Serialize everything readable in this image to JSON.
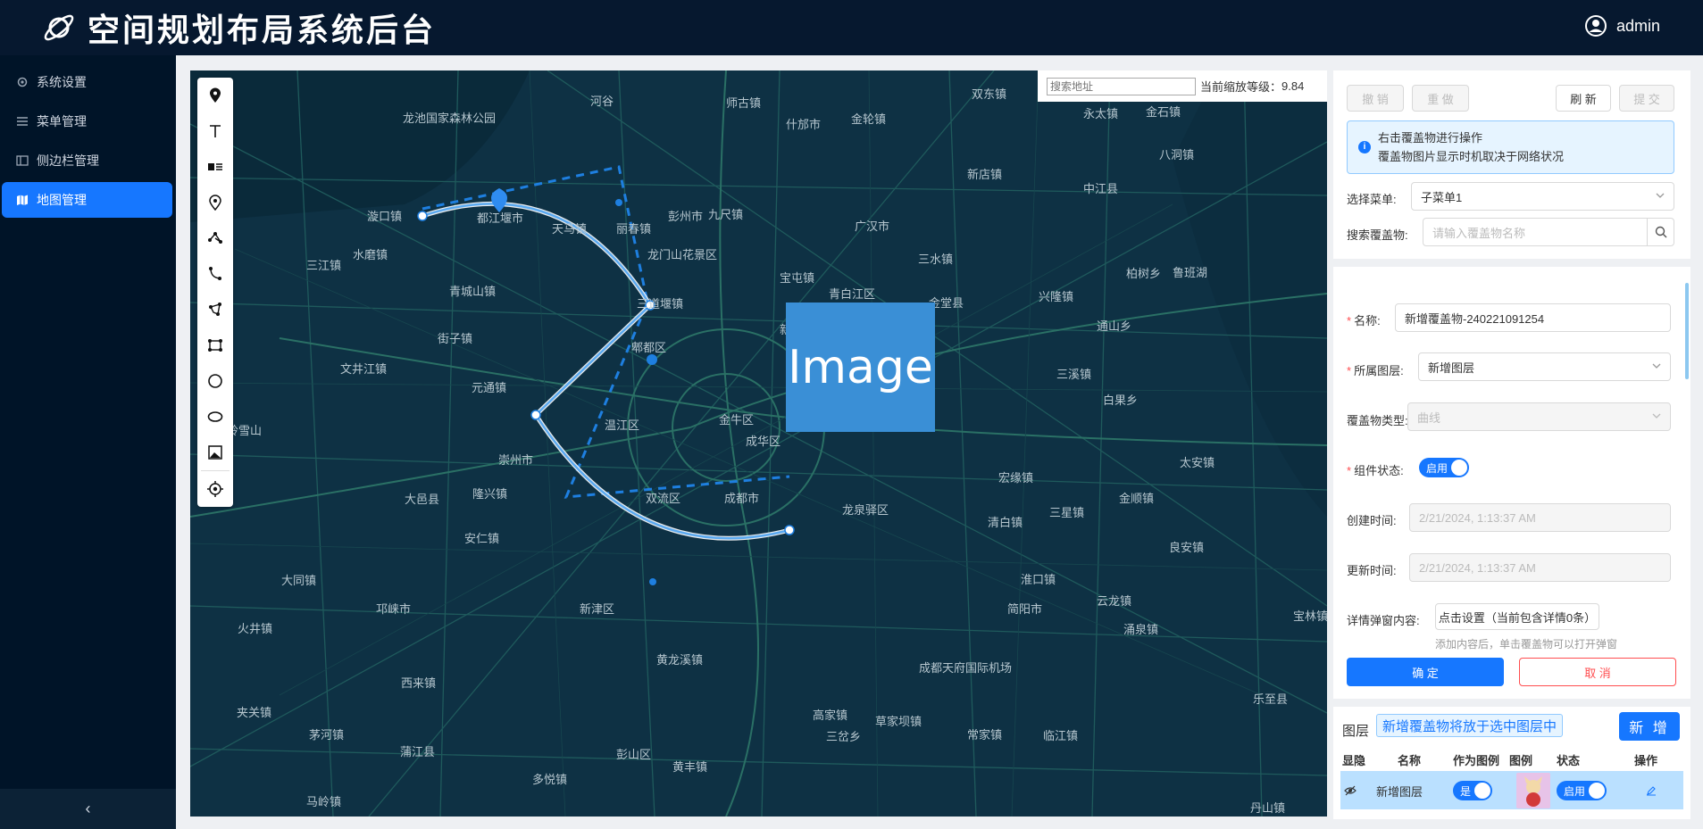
{
  "header": {
    "title": "空间规划布局系统后台",
    "user": "admin"
  },
  "sidebar": {
    "items": [
      {
        "label": "系统设置",
        "icon": "gear-icon"
      },
      {
        "label": "菜单管理",
        "icon": "menu-icon"
      },
      {
        "label": "侧边栏管理",
        "icon": "sidebar-icon"
      },
      {
        "label": "地图管理",
        "icon": "map-icon",
        "active": true
      }
    ],
    "collapse": "‹"
  },
  "map": {
    "search_placeholder": "搜索地址",
    "zoom_label": "当前缩放等级：",
    "zoom_value": "9.84",
    "image_label": "Image",
    "places": [
      "龙池国家森林公园",
      "河谷",
      "师古镇",
      "双东镇",
      "永太镇",
      "金石镇",
      "什邡市",
      "金轮镇",
      "新店镇",
      "八洞镇",
      "都江堰市",
      "天马镇",
      "彭州市",
      "九尺镇",
      "广汉市",
      "三水镇",
      "中江县",
      "漩口镇",
      "水磨镇",
      "丽春镇",
      "龙门山花景区",
      "三江镇",
      "青城山镇",
      "三道堰镇",
      "宝屯镇",
      "青白江区",
      "金堂县",
      "兴隆镇",
      "柏树乡",
      "鲁班湖",
      "街子镇",
      "郫都区",
      "新都区",
      "通山乡",
      "文井江镇",
      "元通镇",
      "白果乡",
      "三溪镇",
      "崇州市",
      "温江区",
      "金牛区",
      "成华区",
      "西岭雪山",
      "大邑县",
      "隆兴镇",
      "双流区",
      "成都市",
      "龙泉驿区",
      "宏缘镇",
      "太安镇",
      "安仁镇",
      "清白镇",
      "金顺镇",
      "三星镇",
      "良安镇",
      "大同镇",
      "邛崃市",
      "新津区",
      "淮口镇",
      "简阳市",
      "火井镇",
      "云龙镇",
      "涌泉镇",
      "宝林镇",
      "西来镇",
      "黄龙溪镇",
      "成都天府国际机场",
      "乐至县",
      "夹关镇",
      "高家镇",
      "草家坝镇",
      "茅河镇",
      "三岔乡",
      "蒲江县",
      "彭山区",
      "常家镇",
      "临江镇",
      "多悦镇",
      "黄丰镇",
      "马岭镇",
      "丹山镇"
    ]
  },
  "toolbar": {
    "tools": [
      "marker-icon",
      "text-icon",
      "label-card-icon",
      "point-icon",
      "polyline-icon",
      "curve-icon",
      "polygon-icon",
      "rectangle-icon",
      "circle-icon",
      "ellipse-icon",
      "image-icon",
      "locate-icon"
    ]
  },
  "panel_top": {
    "undo": "撤 销",
    "redo": "重 做",
    "refresh": "刷 新",
    "submit": "提 交",
    "alert_line1": "右击覆盖物进行操作",
    "alert_line2": "覆盖物图片显示时机取决于网络状况",
    "menu_label": "选择菜单:",
    "menu_value": "子菜单1",
    "search_label": "搜索覆盖物:",
    "search_placeholder": "请输入覆盖物名称"
  },
  "form": {
    "name_label": "名称:",
    "name_value": "新增覆盖物-240221091254",
    "layer_label": "所属图层:",
    "layer_value": "新增图层",
    "type_label": "覆盖物类型:",
    "type_value": "曲线",
    "status_label": "组件状态:",
    "status_value": "启用",
    "created_label": "创建时间:",
    "created_value": "2/21/2024, 1:13:37 AM",
    "updated_label": "更新时间:",
    "updated_value": "2/21/2024, 1:13:37 AM",
    "detail_label": "详情弹窗内容:",
    "detail_button": "点击设置（当前包含详情0条）",
    "detail_hint": "添加内容后，单击覆盖物可以打开弹窗",
    "confirm": "确 定",
    "cancel": "取 消"
  },
  "layers": {
    "title": "图层",
    "tag": "新增覆盖物将放于选中图层中",
    "new": "新 增",
    "columns": [
      "显隐",
      "名称",
      "作为图例",
      "图例",
      "状态",
      "操作"
    ],
    "rows": [
      {
        "name": "新增图层",
        "legend_switch": "是",
        "status": "启用"
      }
    ]
  },
  "colors": {
    "primary": "#1677ff",
    "header": "#06182f",
    "sidebar": "#001428",
    "map": "#0e3144"
  }
}
